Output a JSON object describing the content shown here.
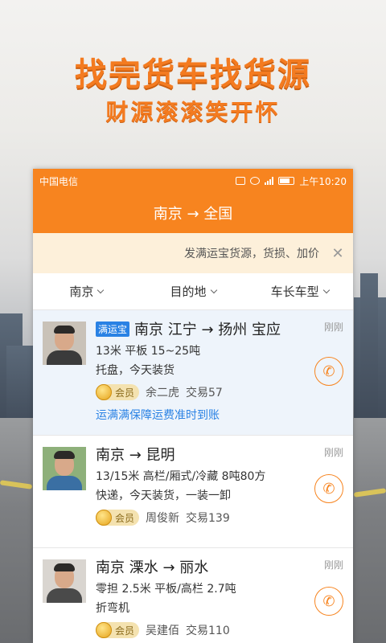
{
  "promo": {
    "headline": "找完货车找货源",
    "subline": "财源滚滚笑开怀"
  },
  "statusbar": {
    "carrier": "中国电信",
    "time": "上午10:20"
  },
  "titlebar": {
    "title": "南京 → 全国"
  },
  "notice": {
    "text": "发满运宝货源，货损、加价",
    "close_icon": "close-icon"
  },
  "filters": [
    {
      "label": "南京"
    },
    {
      "label": "目的地"
    },
    {
      "label": "车长车型"
    }
  ],
  "listings": [
    {
      "tag": "满运宝",
      "route": "南京 江宁 → 扬州 宝应",
      "spec": "13米 平板 15~25吨",
      "notes": "托盘，今天装货",
      "member_label": "会员",
      "name": "余二虎",
      "trades": "交易57",
      "guarantee": "运满满保障运费准时到账",
      "time": "刚刚"
    },
    {
      "route": "南京 → 昆明",
      "spec": "13/15米 高栏/厢式/冷藏 8吨80方",
      "notes": "快递，今天装货，一装一卸",
      "member_label": "会员",
      "name": "周俊新",
      "trades": "交易139",
      "time": "刚刚"
    },
    {
      "route": "南京 溧水 → 丽水",
      "spec": "零担 2.5米 平板/高栏 2.7吨",
      "notes": "折弯机",
      "member_label": "会员",
      "name": "吴建佰",
      "trades": "交易110",
      "time": "刚刚"
    }
  ],
  "colors": {
    "accent": "#f7841f",
    "link": "#2a82e4",
    "notice_bg": "#fdf0da"
  }
}
